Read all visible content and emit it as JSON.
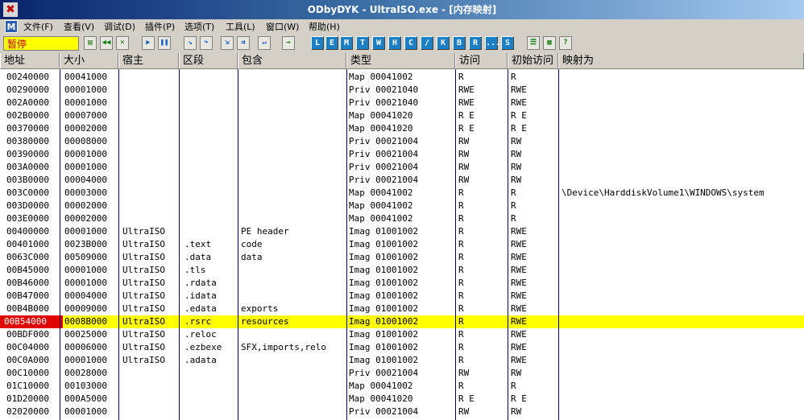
{
  "title": "ODbyDYK - UltraISO.exe - [内存映射]",
  "menu": [
    "文件(F)",
    "查看(V)",
    "调试(D)",
    "插件(P)",
    "选项(T)",
    "工具(L)",
    "窗口(W)",
    "帮助(H)"
  ],
  "menu_m": "M",
  "status": "暂停",
  "toolbar_letters": [
    "L",
    "E",
    "M",
    "T",
    "W",
    "H",
    "C",
    "/",
    "K",
    "B",
    "R",
    "...",
    "S"
  ],
  "columns": [
    "地址",
    "大小",
    "宿主",
    "区段",
    "包含",
    "类型",
    "访问",
    "初始访问",
    "映射为"
  ],
  "rows": [
    {
      "addr": "00240000",
      "size": "00041000",
      "owner": "",
      "section": "",
      "contains": "",
      "type": "Map  00041002",
      "access": "R",
      "init": "R",
      "mapped": ""
    },
    {
      "addr": "00290000",
      "size": "00001000",
      "owner": "",
      "section": "",
      "contains": "",
      "type": "Priv 00021040",
      "access": "RWE",
      "init": "RWE",
      "mapped": ""
    },
    {
      "addr": "002A0000",
      "size": "00001000",
      "owner": "",
      "section": "",
      "contains": "",
      "type": "Priv 00021040",
      "access": "RWE",
      "init": "RWE",
      "mapped": ""
    },
    {
      "addr": "002B0000",
      "size": "00007000",
      "owner": "",
      "section": "",
      "contains": "",
      "type": "Map  00041020",
      "access": "R E",
      "init": "R E",
      "mapped": ""
    },
    {
      "addr": "00370000",
      "size": "00002000",
      "owner": "",
      "section": "",
      "contains": "",
      "type": "Map  00041020",
      "access": "R E",
      "init": "R E",
      "mapped": ""
    },
    {
      "addr": "00380000",
      "size": "00008000",
      "owner": "",
      "section": "",
      "contains": "",
      "type": "Priv 00021004",
      "access": "RW",
      "init": "RW",
      "mapped": ""
    },
    {
      "addr": "00390000",
      "size": "00001000",
      "owner": "",
      "section": "",
      "contains": "",
      "type": "Priv 00021004",
      "access": "RW",
      "init": "RW",
      "mapped": ""
    },
    {
      "addr": "003A0000",
      "size": "00001000",
      "owner": "",
      "section": "",
      "contains": "",
      "type": "Priv 00021004",
      "access": "RW",
      "init": "RW",
      "mapped": ""
    },
    {
      "addr": "003B0000",
      "size": "00004000",
      "owner": "",
      "section": "",
      "contains": "",
      "type": "Priv 00021004",
      "access": "RW",
      "init": "RW",
      "mapped": ""
    },
    {
      "addr": "003C0000",
      "size": "00003000",
      "owner": "",
      "section": "",
      "contains": "",
      "type": "Map  00041002",
      "access": "R",
      "init": "R",
      "mapped": "\\Device\\HarddiskVolume1\\WINDOWS\\system"
    },
    {
      "addr": "003D0000",
      "size": "00002000",
      "owner": "",
      "section": "",
      "contains": "",
      "type": "Map  00041002",
      "access": "R",
      "init": "R",
      "mapped": ""
    },
    {
      "addr": "003E0000",
      "size": "00002000",
      "owner": "",
      "section": "",
      "contains": "",
      "type": "Map  00041002",
      "access": "R",
      "init": "R",
      "mapped": ""
    },
    {
      "addr": "00400000",
      "size": "00001000",
      "owner": "UltraISO",
      "section": "",
      "contains": "PE header",
      "type": "Imag 01001002",
      "access": "R",
      "init": "RWE",
      "mapped": ""
    },
    {
      "addr": "00401000",
      "size": "0023B000",
      "owner": "UltraISO",
      "section": ".text",
      "contains": "code",
      "type": "Imag 01001002",
      "access": "R",
      "init": "RWE",
      "mapped": ""
    },
    {
      "addr": "0063C000",
      "size": "00509000",
      "owner": "UltraISO",
      "section": ".data",
      "contains": "data",
      "type": "Imag 01001002",
      "access": "R",
      "init": "RWE",
      "mapped": ""
    },
    {
      "addr": "00B45000",
      "size": "00001000",
      "owner": "UltraISO",
      "section": ".tls",
      "contains": "",
      "type": "Imag 01001002",
      "access": "R",
      "init": "RWE",
      "mapped": ""
    },
    {
      "addr": "00B46000",
      "size": "00001000",
      "owner": "UltraISO",
      "section": ".rdata",
      "contains": "",
      "type": "Imag 01001002",
      "access": "R",
      "init": "RWE",
      "mapped": ""
    },
    {
      "addr": "00B47000",
      "size": "00004000",
      "owner": "UltraISO",
      "section": ".idata",
      "contains": "",
      "type": "Imag 01001002",
      "access": "R",
      "init": "RWE",
      "mapped": ""
    },
    {
      "addr": "00B4B000",
      "size": "00009000",
      "owner": "UltraISO",
      "section": ".edata",
      "contains": "exports",
      "type": "Imag 01001002",
      "access": "R",
      "init": "RWE",
      "mapped": ""
    },
    {
      "addr": "00B54000",
      "size": "0008B000",
      "owner": "UltraISO",
      "section": ".rsrc",
      "contains": "resources",
      "type": "Imag 01001002",
      "access": "R",
      "init": "RWE",
      "mapped": "",
      "selected": true
    },
    {
      "addr": "00BDF000",
      "size": "00025000",
      "owner": "UltraISO",
      "section": ".reloc",
      "contains": "",
      "type": "Imag 01001002",
      "access": "R",
      "init": "RWE",
      "mapped": ""
    },
    {
      "addr": "00C04000",
      "size": "00006000",
      "owner": "UltraISO",
      "section": ".ezbexe",
      "contains": "SFX,imports,relo",
      "type": "Imag 01001002",
      "access": "R",
      "init": "RWE",
      "mapped": ""
    },
    {
      "addr": "00C0A000",
      "size": "00001000",
      "owner": "UltraISO",
      "section": ".adata",
      "contains": "",
      "type": "Imag 01001002",
      "access": "R",
      "init": "RWE",
      "mapped": ""
    },
    {
      "addr": "00C10000",
      "size": "00028000",
      "owner": "",
      "section": "",
      "contains": "",
      "type": "Priv 00021004",
      "access": "RW",
      "init": "RW",
      "mapped": ""
    },
    {
      "addr": "01C10000",
      "size": "00103000",
      "owner": "",
      "section": "",
      "contains": "",
      "type": "Map  00041002",
      "access": "R",
      "init": "R",
      "mapped": ""
    },
    {
      "addr": "01D20000",
      "size": "000A5000",
      "owner": "",
      "section": "",
      "contains": "",
      "type": "Map  00041020",
      "access": "R E",
      "init": "R E",
      "mapped": ""
    },
    {
      "addr": "02020000",
      "size": "00001000",
      "owner": "",
      "section": "",
      "contains": "",
      "type": "Priv 00021004",
      "access": "RW",
      "init": "RW",
      "mapped": ""
    }
  ]
}
